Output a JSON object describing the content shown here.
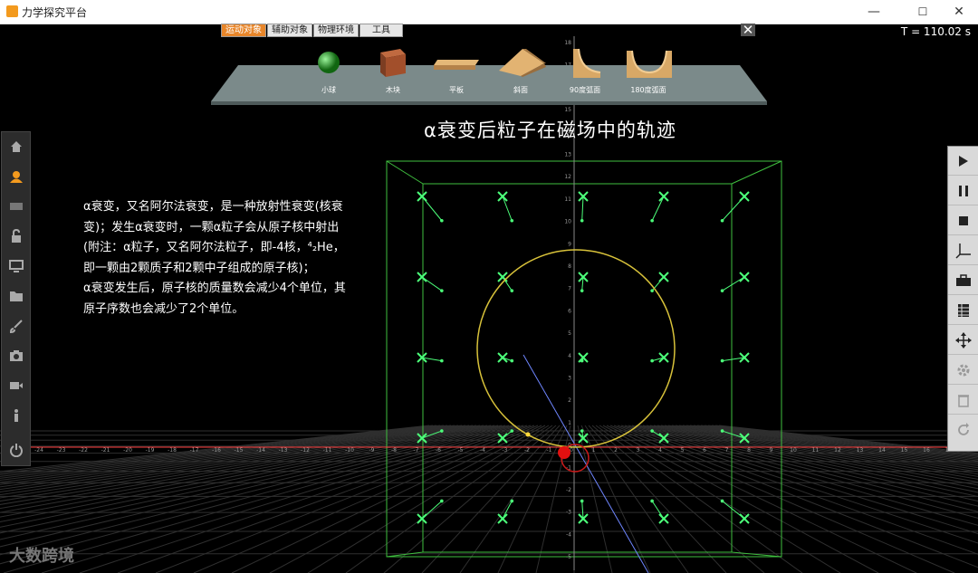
{
  "window": {
    "title": "力学探究平台",
    "minimize": "—",
    "maximize": "☐",
    "close": "✕"
  },
  "timer": "T = 110.02 s",
  "tabs": [
    "运动对象",
    "辅助对象",
    "物理环境",
    "工具"
  ],
  "panel_close": "✕",
  "palette": [
    "小球",
    "木块",
    "平板",
    "斜面",
    "90度弧面",
    "180度弧面"
  ],
  "heading": "α衰变后粒子在磁场中的轨迹",
  "description": [
    "α衰变，又名阿尔法衰变，是一种放射性衰变(核衰变)；发生α衰变时，一颗α粒子会从原子核中射出(附注：α粒子，又名阿尔法粒子，即-4核，⁴₂He，即一颗由2颗质子和2颗中子组成的原子核)；",
    "α衰变发生后，原子核的质量数会减少4个单位，其原子序数也会减少了2个单位。"
  ],
  "x_ticks": [
    "-24",
    "-23",
    "-22",
    "-21",
    "-20",
    "-19",
    "-18",
    "-17",
    "-16",
    "-15",
    "-14",
    "-13",
    "-12",
    "-11",
    "-10",
    "-9",
    "-8",
    "-7",
    "-6",
    "-5",
    "-4",
    "-3",
    "-2",
    "-1",
    "0",
    "1",
    "2",
    "3",
    "4",
    "5",
    "6",
    "7",
    "8",
    "9",
    "10",
    "11",
    "12",
    "13",
    "14",
    "15",
    "16",
    "17"
  ],
  "y_ticks": [
    "18",
    "17",
    "16",
    "15",
    "14",
    "13",
    "12",
    "11",
    "10",
    "9",
    "8",
    "7",
    "6",
    "5",
    "4",
    "3",
    "2",
    "1",
    "0",
    "-1",
    "-2",
    "-3",
    "-4",
    "-5"
  ],
  "left_toolbar": [
    "home-icon",
    "user-icon",
    "panel-icon",
    "unlock-icon",
    "monitor-icon",
    "folder-icon",
    "brush-icon",
    "camera-icon",
    "video-icon",
    "info-icon",
    "power-icon"
  ],
  "right_toolbar": [
    "play-icon",
    "pause-icon",
    "stop-icon",
    "axes-icon",
    "toolbox-icon",
    "table-icon",
    "move-icon",
    "gear-icon",
    "trash-icon",
    "reset-icon"
  ],
  "watermark": "大数跨境",
  "colors": {
    "grid": "#2f2f2f",
    "box": "#3fbf3f",
    "marker": "#4cff7a",
    "trajectory": "#d8c23a",
    "axis": "#ff3b3b",
    "ball": "#e01010"
  }
}
